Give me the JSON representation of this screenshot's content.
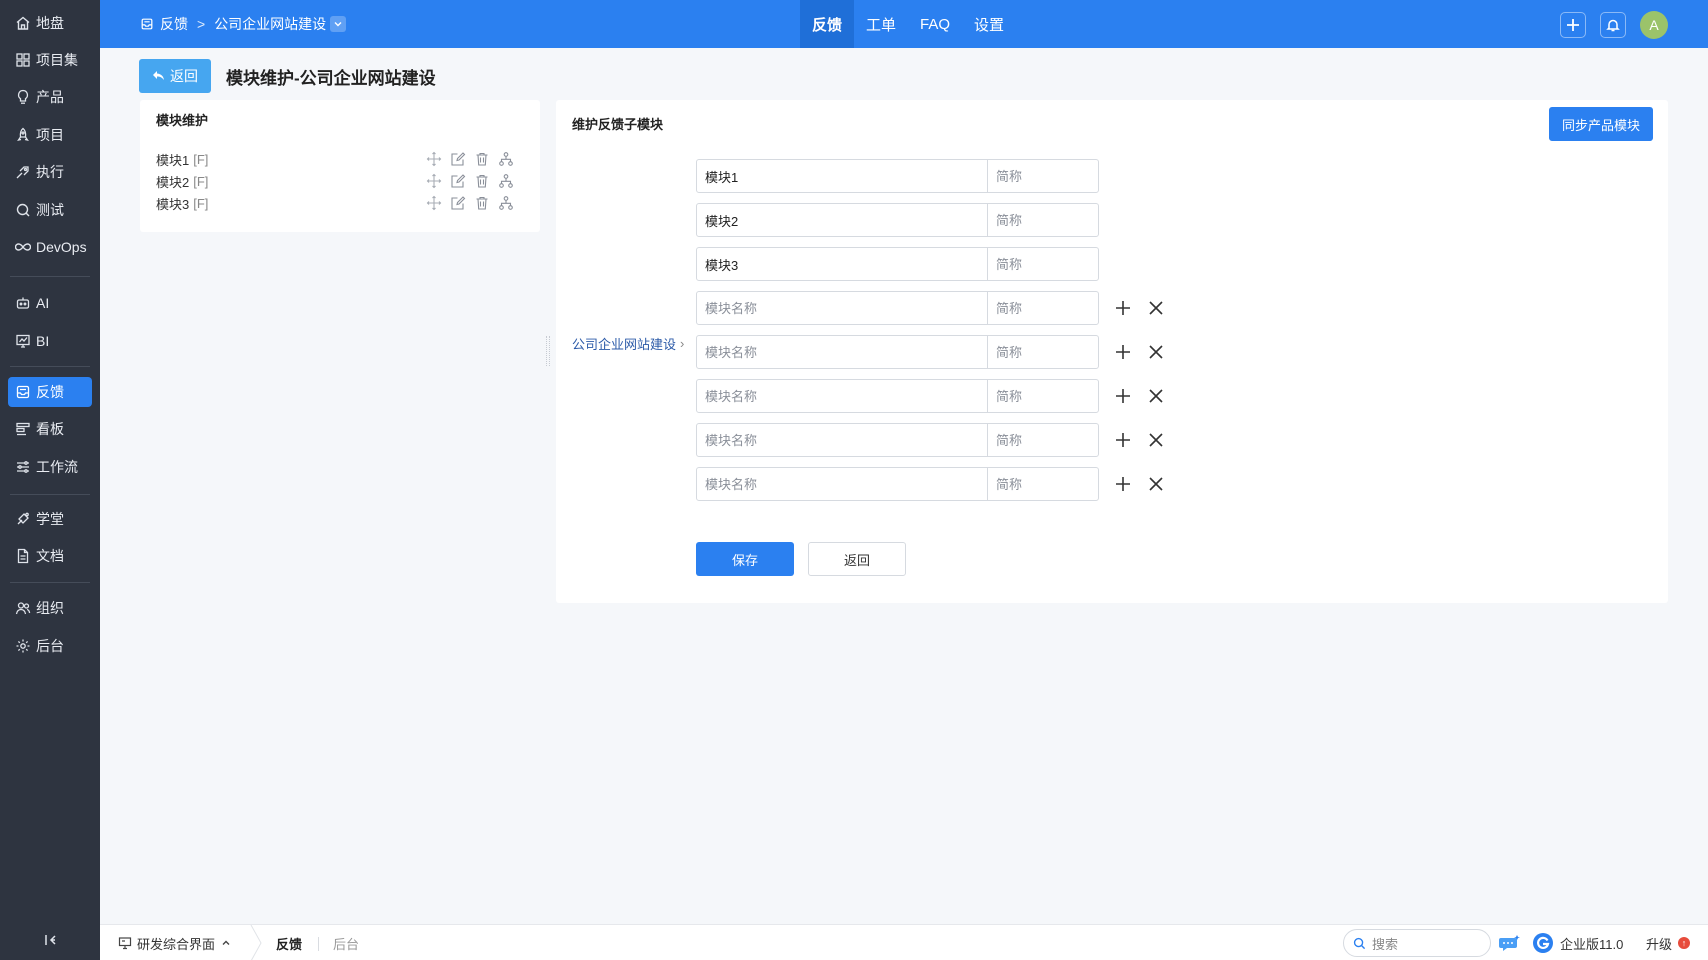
{
  "sidebar": {
    "items": [
      {
        "label": "地盘",
        "icon": "home-icon"
      },
      {
        "label": "项目集",
        "icon": "grid-icon"
      },
      {
        "label": "产品",
        "icon": "bulb-icon"
      },
      {
        "label": "项目",
        "icon": "rocket-icon"
      },
      {
        "label": "执行",
        "icon": "run-icon"
      },
      {
        "label": "测试",
        "icon": "magnifier-icon"
      },
      {
        "label": "DevOps",
        "icon": "infinity-icon"
      },
      {
        "label": "AI",
        "icon": "robot-icon"
      },
      {
        "label": "BI",
        "icon": "chart-board-icon"
      },
      {
        "label": "反馈",
        "icon": "inbox-icon",
        "active": true
      },
      {
        "label": "看板",
        "icon": "kanban-icon"
      },
      {
        "label": "工作流",
        "icon": "workflow-icon"
      },
      {
        "label": "学堂",
        "icon": "school-icon"
      },
      {
        "label": "文档",
        "icon": "document-icon"
      },
      {
        "label": "组织",
        "icon": "users-icon"
      },
      {
        "label": "后台",
        "icon": "gear-icon"
      }
    ]
  },
  "header": {
    "breadcrumb": {
      "root": "反馈",
      "separator": ">",
      "current": "公司企业网站建设"
    },
    "nav": [
      "反馈",
      "工单",
      "FAQ",
      "设置"
    ],
    "active_nav": "反馈",
    "avatar_letter": "A",
    "brand_color": "#2b80f0"
  },
  "page": {
    "back_label": "返回",
    "title": "模块维护-公司企业网站建设"
  },
  "tree": {
    "title": "模块维护",
    "items": [
      {
        "name": "模块1",
        "flag": "[F]"
      },
      {
        "name": "模块2",
        "flag": "[F]"
      },
      {
        "name": "模块3",
        "flag": "[F]"
      }
    ]
  },
  "editor": {
    "title": "维护反馈子模块",
    "sync_label": "同步产品模块",
    "parent_label": "公司企业网站建设",
    "name_placeholder": "模块名称",
    "short_placeholder": "简称",
    "rows": [
      {
        "name": "模块1",
        "short": ""
      },
      {
        "name": "模块2",
        "short": ""
      },
      {
        "name": "模块3",
        "short": ""
      },
      {
        "name": "",
        "short": ""
      },
      {
        "name": "",
        "short": ""
      },
      {
        "name": "",
        "short": ""
      },
      {
        "name": "",
        "short": ""
      },
      {
        "name": "",
        "short": ""
      }
    ],
    "save_label": "保存",
    "return_label": "返回"
  },
  "footer": {
    "workspace": "研发综合界面",
    "tabs": [
      "反馈",
      "后台"
    ],
    "search_placeholder": "搜索",
    "edition": "企业版11.0",
    "upgrade": "升级"
  }
}
